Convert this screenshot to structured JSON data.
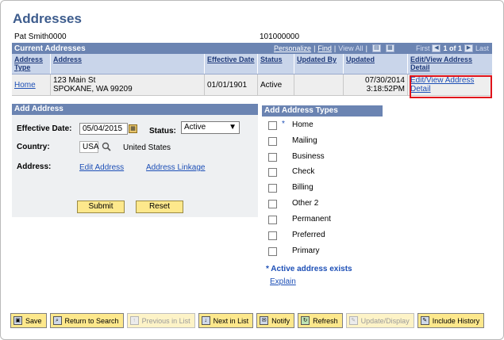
{
  "page": {
    "title": "Addresses",
    "person_name": "Pat Smith0000",
    "person_id": "101000000"
  },
  "grid": {
    "title": "Current Addresses",
    "nav": {
      "personalize": "Personalize",
      "find": "Find",
      "view_all": "View All",
      "first": "First",
      "range": "1 of 1",
      "last": "Last"
    },
    "columns": [
      "Address Type",
      "Address",
      "Effective Date",
      "Status",
      "Updated By",
      "Updated",
      "Edit/View Address Detail"
    ],
    "rows": [
      {
        "type": "Home",
        "address_line1": "123 Main St",
        "address_line2": "SPOKANE, WA 99209",
        "effective_date": "01/01/1901",
        "status": "Active",
        "updated_by": "",
        "updated_date": "07/30/2014",
        "updated_time": "3:18:52PM",
        "detail_link": "Edit/View Address Detail"
      }
    ]
  },
  "add_address": {
    "title": "Add Address",
    "effective_date_label": "Effective Date:",
    "effective_date_value": "05/04/2015",
    "status_label": "Status:",
    "status_value": "Active",
    "country_label": "Country:",
    "country_code": "USA",
    "country_name": "United States",
    "address_label": "Address:",
    "edit_address_link": "Edit Address",
    "address_linkage_link": "Address Linkage",
    "submit_label": "Submit",
    "reset_label": "Reset"
  },
  "address_types": {
    "title": "Add Address Types",
    "items": [
      {
        "label": "Home",
        "star": "*"
      },
      {
        "label": "Mailing",
        "star": ""
      },
      {
        "label": "Business",
        "star": ""
      },
      {
        "label": "Check",
        "star": ""
      },
      {
        "label": "Billing",
        "star": ""
      },
      {
        "label": "Other 2",
        "star": ""
      },
      {
        "label": "Permanent",
        "star": ""
      },
      {
        "label": "Preferred",
        "star": ""
      },
      {
        "label": "Primary",
        "star": ""
      }
    ],
    "note": "* Active address exists",
    "explain_link": "Explain"
  },
  "toolbar": {
    "save": "Save",
    "return_to_search": "Return to Search",
    "previous_in_list": "Previous in List",
    "next_in_list": "Next in List",
    "notify": "Notify",
    "refresh": "Refresh",
    "update_display": "Update/Display",
    "include_history": "Include History"
  },
  "colors": {
    "header_blue": "#6b84b2",
    "title_blue": "#3d5c8d",
    "link_blue": "#1d4fb6",
    "button_yellow": "#fde88c",
    "highlight_red": "#e0131b"
  }
}
